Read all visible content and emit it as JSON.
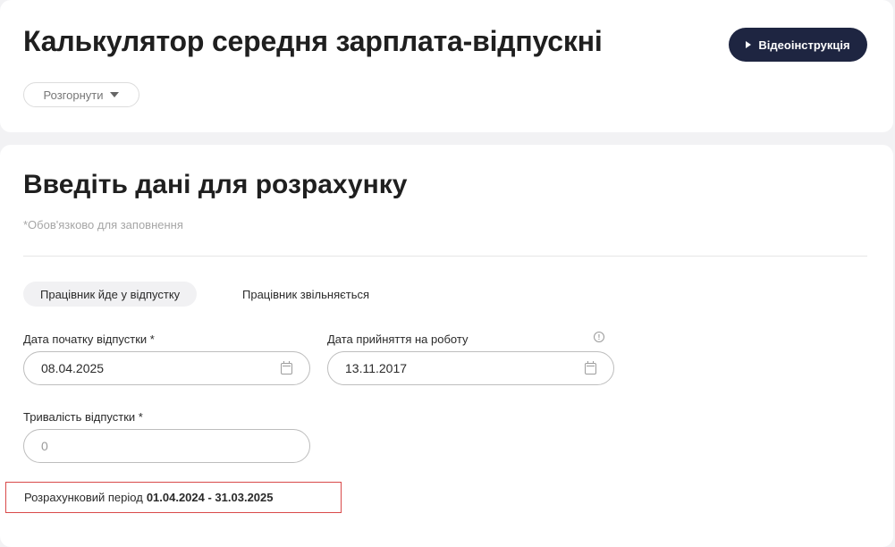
{
  "header": {
    "title": "Калькулятор середня зарплата-відпускні",
    "video_button_label": "Відеоінструкція",
    "expand_button_label": "Розгорнути"
  },
  "form": {
    "title": "Введіть дані для розрахунку",
    "required_note": "*Обов'язково для заповнення",
    "tabs": [
      {
        "label": "Працівник йде у відпустку",
        "active": true
      },
      {
        "label": "Працівник звільняється",
        "active": false
      }
    ],
    "fields": {
      "vacation_start": {
        "label": "Дата початку відпустки *",
        "value": "08.04.2025"
      },
      "hire_date": {
        "label": "Дата прийняття на роботу",
        "value": "13.11.2017"
      },
      "duration": {
        "label": "Тривалість відпустки *",
        "placeholder": "0"
      }
    },
    "period": {
      "label": "Розрахунковий період",
      "value": "01.04.2024 - 31.03.2025"
    }
  },
  "colors": {
    "page_background": "#f2f2f4",
    "card_background": "#ffffff",
    "primary_button": "#1e2541",
    "highlight_border": "#d94a4a"
  },
  "icons": [
    "play-icon",
    "caret-down-icon",
    "calendar-icon",
    "info-icon"
  ]
}
